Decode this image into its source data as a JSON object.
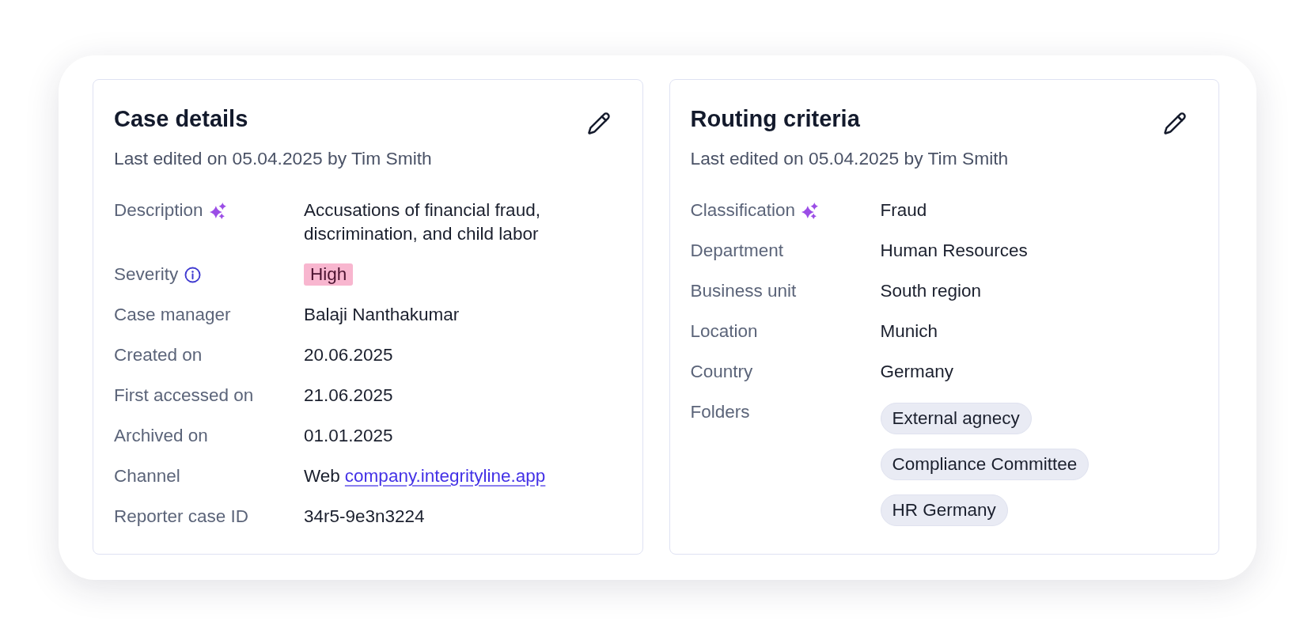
{
  "cards": [
    {
      "title": "Case details",
      "subtitle": "Last edited on 05.04.2025 by Tim Smith",
      "fields": [
        {
          "label": "Description",
          "ai_suggested": true,
          "info": false,
          "kind": "text",
          "value": "Accusations of financial fraud, discrimination, and child labor"
        },
        {
          "label": "Severity",
          "ai_suggested": false,
          "info": true,
          "kind": "badge",
          "value": "High"
        },
        {
          "label": "Case manager",
          "ai_suggested": false,
          "info": false,
          "kind": "text",
          "value": "Balaji Nanthakumar"
        },
        {
          "label": "Created on",
          "ai_suggested": false,
          "info": false,
          "kind": "text",
          "value": "20.06.2025"
        },
        {
          "label": "First accessed on",
          "ai_suggested": false,
          "info": false,
          "kind": "text",
          "value": "21.06.2025"
        },
        {
          "label": "Archived on",
          "ai_suggested": false,
          "info": false,
          "kind": "text",
          "value": "01.01.2025"
        },
        {
          "label": "Channel",
          "ai_suggested": false,
          "info": false,
          "kind": "link",
          "value": "Web",
          "link": "company.integrityline.app"
        },
        {
          "label": "Reporter case ID",
          "ai_suggested": false,
          "info": false,
          "kind": "text",
          "value": "34r5-9e3n3224"
        }
      ]
    },
    {
      "title": "Routing criteria",
      "subtitle": "Last edited on 05.04.2025 by Tim Smith",
      "fields": [
        {
          "label": "Classification",
          "ai_suggested": true,
          "info": false,
          "kind": "text",
          "value": "Fraud"
        },
        {
          "label": "Department",
          "ai_suggested": false,
          "info": false,
          "kind": "text",
          "value": "Human Resources"
        },
        {
          "label": "Business unit",
          "ai_suggested": false,
          "info": false,
          "kind": "text",
          "value": "South region"
        },
        {
          "label": "Location",
          "ai_suggested": false,
          "info": false,
          "kind": "text",
          "value": "Munich"
        },
        {
          "label": "Country",
          "ai_suggested": false,
          "info": false,
          "kind": "text",
          "value": "Germany"
        },
        {
          "label": "Folders",
          "ai_suggested": false,
          "info": false,
          "kind": "chips",
          "values": [
            "External agnecy",
            "Compliance Committee",
            "HR Germany"
          ]
        }
      ]
    }
  ]
}
